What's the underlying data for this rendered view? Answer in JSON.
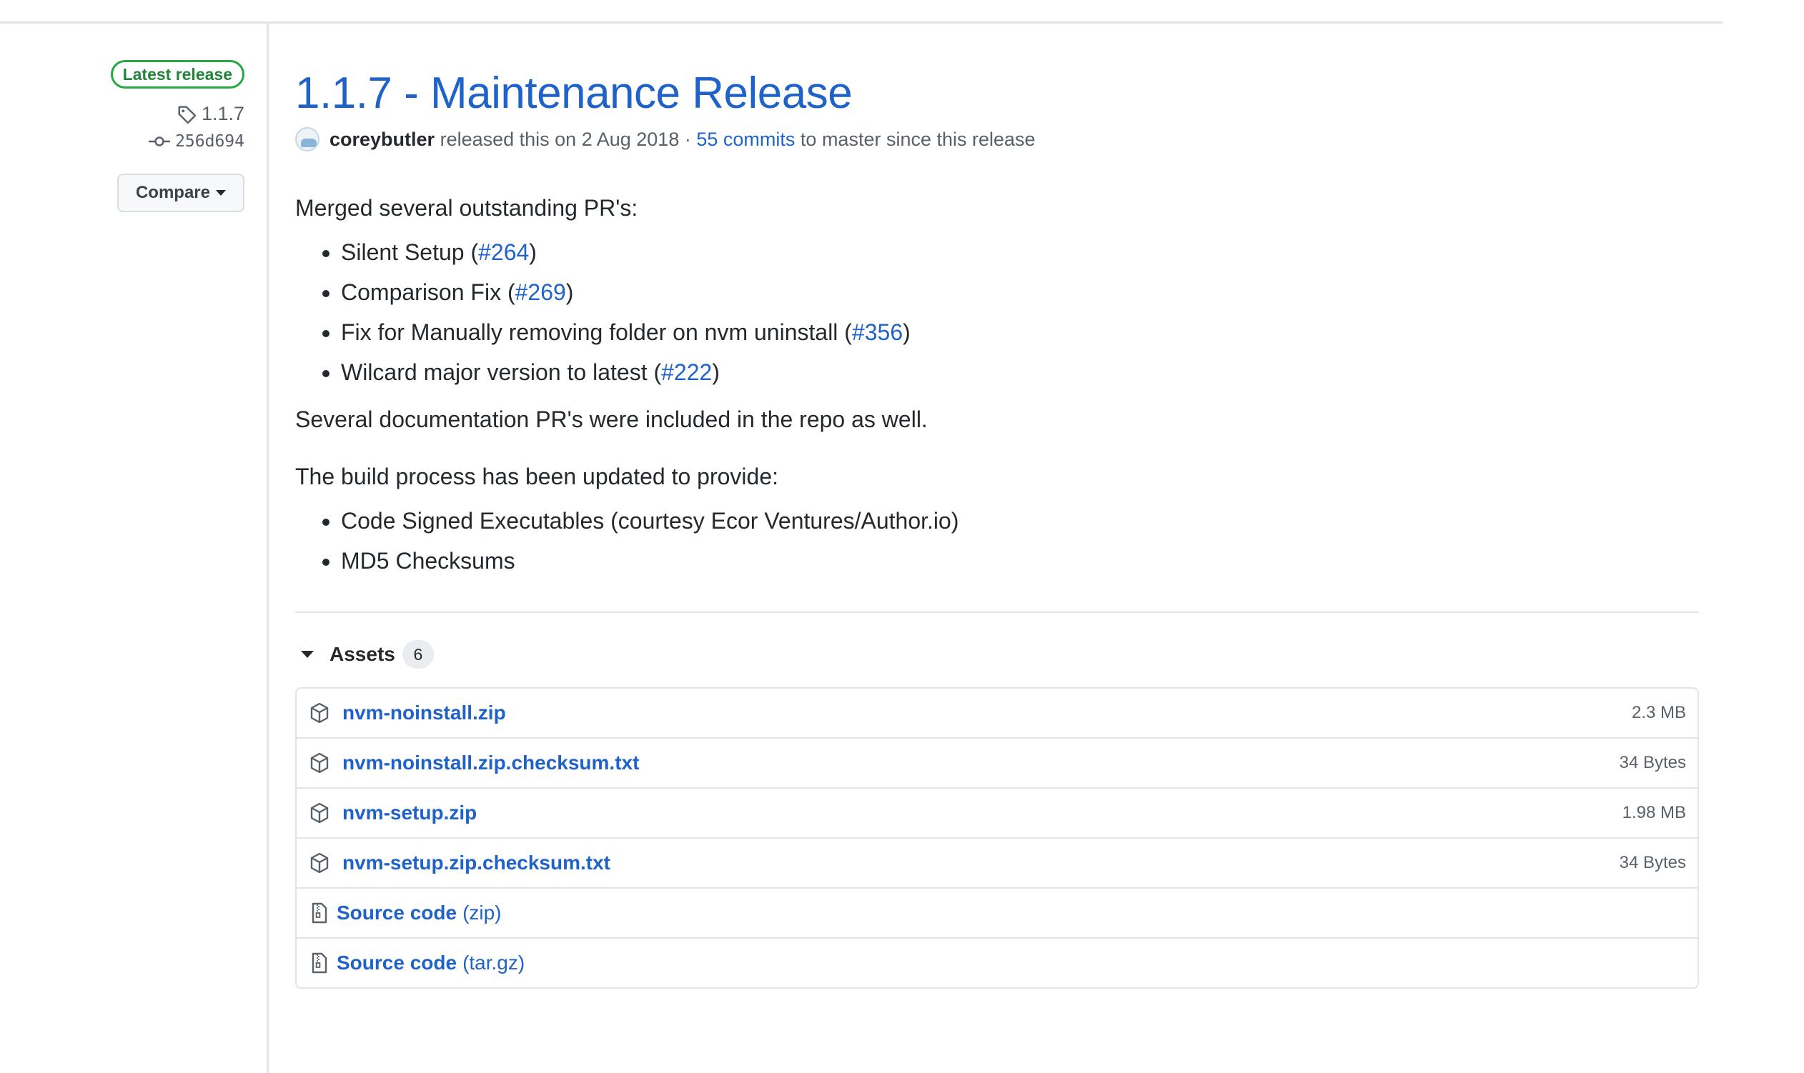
{
  "sidebar": {
    "badge": "Latest release",
    "tag": "1.1.7",
    "commit": "256d694",
    "compare_label": "Compare"
  },
  "release": {
    "title": "1.1.7 - Maintenance Release",
    "author": "coreybutler",
    "released_text": "released this on 2 Aug 2018 ·",
    "commits_link": "55 commits",
    "commits_suffix": "to master since this release"
  },
  "notes": {
    "intro": "Merged several outstanding PR's:",
    "pr_items": [
      {
        "text": "Silent Setup (",
        "link": "#264",
        "close": ")"
      },
      {
        "text": "Comparison Fix (",
        "link": "#269",
        "close": ")"
      },
      {
        "text": "Fix for Manually removing folder on nvm uninstall (",
        "link": "#356",
        "close": ")"
      },
      {
        "text": "Wilcard major version to latest (",
        "link": "#222",
        "close": ")"
      }
    ],
    "docs_line": "Several documentation PR's were included in the repo as well.",
    "build_intro": "The build process has been updated to provide:",
    "build_items": [
      "Code Signed Executables (courtesy Ecor Ventures/Author.io)",
      "MD5 Checksums"
    ]
  },
  "assets": {
    "label": "Assets",
    "count": "6",
    "files": [
      {
        "name": "nvm-noinstall.zip",
        "size": "2.3 MB",
        "icon": "package-icon"
      },
      {
        "name": "nvm-noinstall.zip.checksum.txt",
        "size": "34 Bytes",
        "icon": "package-icon"
      },
      {
        "name": "nvm-setup.zip",
        "size": "1.98 MB",
        "icon": "package-icon"
      },
      {
        "name": "nvm-setup.zip.checksum.txt",
        "size": "34 Bytes",
        "icon": "package-icon"
      },
      {
        "name": "Source code",
        "sub": "(zip)",
        "icon": "file-zip-icon"
      },
      {
        "name": "Source code",
        "sub": "(tar.gz)",
        "icon": "file-zip-icon"
      }
    ]
  },
  "colors": {
    "link": "#1f62c9",
    "badge_green": "#28a745",
    "muted": "#586069",
    "border": "#e1e4e8"
  }
}
